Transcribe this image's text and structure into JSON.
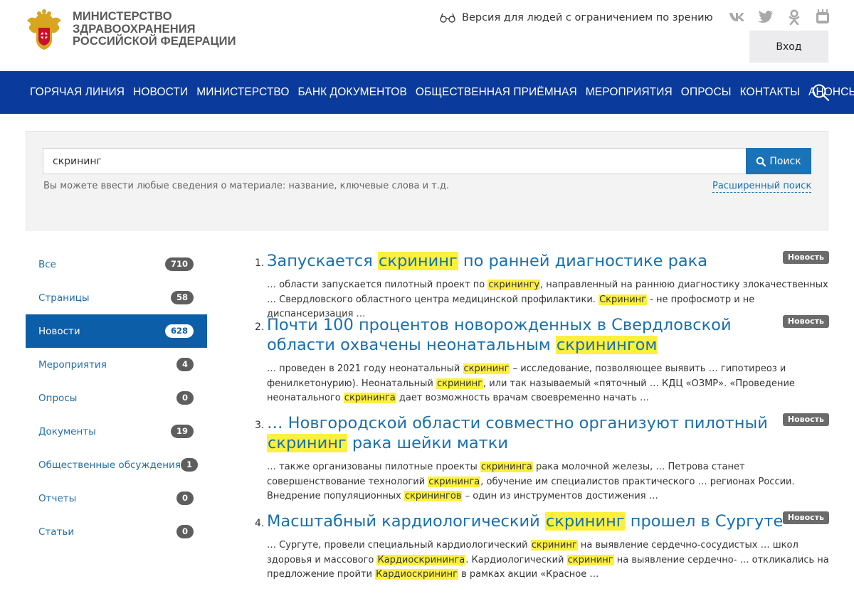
{
  "header": {
    "logo_lines": [
      "МИНИСТЕРСТВО",
      "ЗДРАВООХРАНЕНИЯ",
      "РОССИЙСКОЙ ФЕДЕРАЦИИ"
    ],
    "vision_label": "Версия для людей с ограничением по зрению",
    "login_label": "Вход",
    "socials": [
      "vk-icon",
      "twitter-icon",
      "odnoklassniki-icon",
      "youtube-icon"
    ]
  },
  "nav": {
    "items": [
      "ГОРЯЧАЯ ЛИНИЯ",
      "НОВОСТИ",
      "МИНИСТЕРСТВО",
      "БАНК ДОКУМЕНТОВ",
      "ОБЩЕСТВЕННАЯ ПРИЁМНАЯ",
      "МЕРОПРИЯТИЯ",
      "ОПРОСЫ",
      "КОНТАКТЫ",
      "АНОНСЫ"
    ]
  },
  "search": {
    "value": "скрининг",
    "button_label": "Поиск",
    "hint": "Вы можете ввести любые сведения о материале: название, ключевые слова и т.д.",
    "advanced_label": "Расширенный поиск"
  },
  "sidebar": {
    "items": [
      {
        "label": "Все",
        "count": "710",
        "active": false
      },
      {
        "label": "Страницы",
        "count": "58",
        "active": false
      },
      {
        "label": "Новости",
        "count": "628",
        "active": true
      },
      {
        "label": "Мероприятия",
        "count": "4",
        "active": false
      },
      {
        "label": "Опросы",
        "count": "0",
        "active": false
      },
      {
        "label": "Документы",
        "count": "19",
        "active": false
      },
      {
        "label": "Общественные обсуждения",
        "count": "1",
        "active": false
      },
      {
        "label": "Отчеты",
        "count": "0",
        "active": false
      },
      {
        "label": "Статьи",
        "count": "0",
        "active": false
      }
    ]
  },
  "results": [
    {
      "num": "1.",
      "badge": "Новость",
      "title": [
        {
          "t": "Запускается "
        },
        {
          "t": "скрининг",
          "h": true
        },
        {
          "t": " по ранней диагностике рака"
        }
      ],
      "snippet": [
        {
          "t": "… области запускается пилотный проект по "
        },
        {
          "t": "скринингу",
          "h": true
        },
        {
          "t": ", направленный на раннюю диагностику злокачественных … Свердловского областного центра медицинской профилактики. "
        },
        {
          "t": "Скрининг",
          "h": true
        },
        {
          "t": " - не профосмотр и не диспансеризация …"
        }
      ]
    },
    {
      "num": "2.",
      "badge": "Новость",
      "title": [
        {
          "t": "Почти 100 процентов новорожденных в Свердловской области охвачены неонатальным "
        },
        {
          "t": "скринингом",
          "h": true
        }
      ],
      "snippet": [
        {
          "t": "… проведен в 2021 году неонатальный "
        },
        {
          "t": "скрининг",
          "h": true
        },
        {
          "t": " – исследование, позволяющее выявить … гипотиреоз и фенилкетонурию). Неонатальный "
        },
        {
          "t": "скрининг",
          "h": true
        },
        {
          "t": ", или так называемый «пяточный … КДЦ «ОЗМР». «Проведение неонатального "
        },
        {
          "t": "скрининга",
          "h": true
        },
        {
          "t": " дает возможность врачам своевременно начать …"
        }
      ]
    },
    {
      "num": "3.",
      "badge": "Новость",
      "title": [
        {
          "t": "… Новгородской области совместно организуют пилотный "
        },
        {
          "t": "скрининг",
          "h": true
        },
        {
          "t": " рака шейки матки"
        }
      ],
      "snippet": [
        {
          "t": "… также организованы пилотные проекты "
        },
        {
          "t": "скрининга",
          "h": true
        },
        {
          "t": " рака молочной железы, … Петрова станет совершенствование технологий "
        },
        {
          "t": "скрининга",
          "h": true
        },
        {
          "t": ", обучение им специалистов практического … регионах России. Внедрение популяционных "
        },
        {
          "t": "скринингов",
          "h": true
        },
        {
          "t": " – один из инструментов достижения …"
        }
      ]
    },
    {
      "num": "4.",
      "badge": "Новость",
      "title": [
        {
          "t": "Масштабный кардиологический "
        },
        {
          "t": "скрининг",
          "h": true
        },
        {
          "t": " прошел в Сургуте"
        }
      ],
      "snippet": [
        {
          "t": "… Сургуте, провели специальный кардиологический "
        },
        {
          "t": "скрининг",
          "h": true
        },
        {
          "t": " на выявление сердечно-сосудистых … школ здоровья и массового "
        },
        {
          "t": "Кардиоскрининга",
          "h": true
        },
        {
          "t": ". Кардиологический "
        },
        {
          "t": "скрининг",
          "h": true
        },
        {
          "t": " на выявление сердечно- … откликались на предложение пройти "
        },
        {
          "t": "Кардиоскрининг",
          "h": true
        },
        {
          "t": " в рамках акции «Красное …"
        }
      ]
    }
  ],
  "colors": {
    "nav_bg": "#0a3a9c",
    "link": "#1a6fae",
    "search_button": "#1a73b7",
    "sidebar_active": "#0d5ea8",
    "highlight": "#fef03e",
    "badge": "#6b6b6b"
  }
}
